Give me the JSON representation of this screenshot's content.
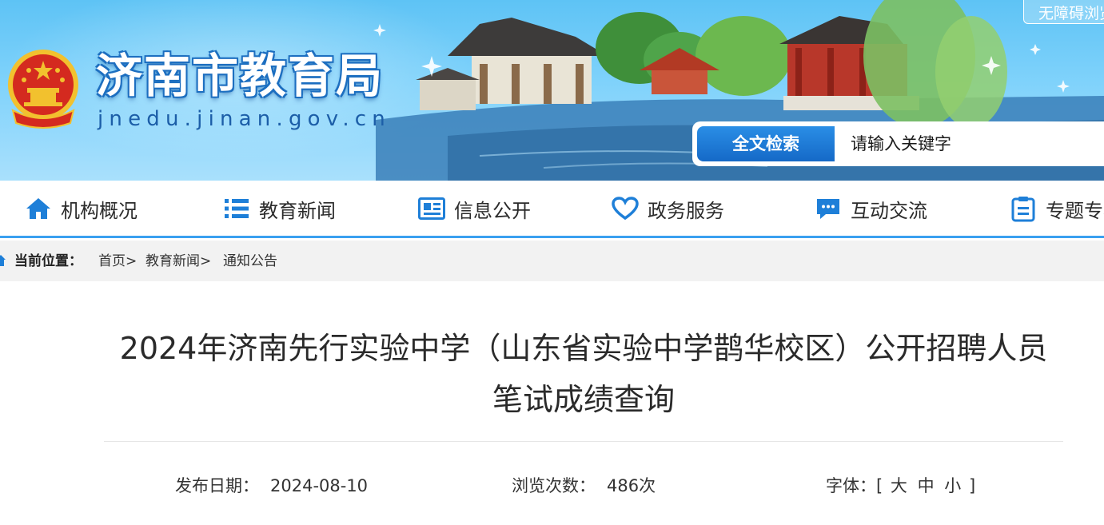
{
  "header": {
    "site_name": "济南市教育局",
    "site_domain": "jnedu.jinan.gov.cn",
    "accessible_label": "无障碍浏览",
    "search": {
      "button_label": "全文检索",
      "placeholder": "请输入关键字"
    }
  },
  "nav": {
    "items": [
      {
        "label": "机构概况",
        "icon": "home-icon"
      },
      {
        "label": "教育新闻",
        "icon": "list-icon"
      },
      {
        "label": "信息公开",
        "icon": "newspaper-icon"
      },
      {
        "label": "政务服务",
        "icon": "heart-icon"
      },
      {
        "label": "互动交流",
        "icon": "chat-icon"
      },
      {
        "label": "专题专栏",
        "icon": "clipboard-icon"
      }
    ]
  },
  "breadcrumb": {
    "label": "当前位置：",
    "items": [
      "首页>",
      "教育新闻>",
      "通知公告"
    ]
  },
  "article": {
    "title_line1": "2024年济南先行实验中学（山东省实验中学鹊华校区）公开招聘人员",
    "title_line2": "笔试成绩查询",
    "publish_label": "发布日期：",
    "publish_date": "2024-08-10",
    "views_label": "浏览次数：",
    "views_value": "486次",
    "font_label": "字体：",
    "font_open": "[",
    "font_large": "大",
    "font_medium": "中",
    "font_small": "小",
    "font_close": "]"
  },
  "colors": {
    "accent_blue": "#1569c7",
    "nav_icon_blue": "#1e7fd8",
    "nav_underline": "#3aa0f0",
    "emblem_red": "#d42a1f",
    "emblem_gold": "#f2c12e"
  }
}
